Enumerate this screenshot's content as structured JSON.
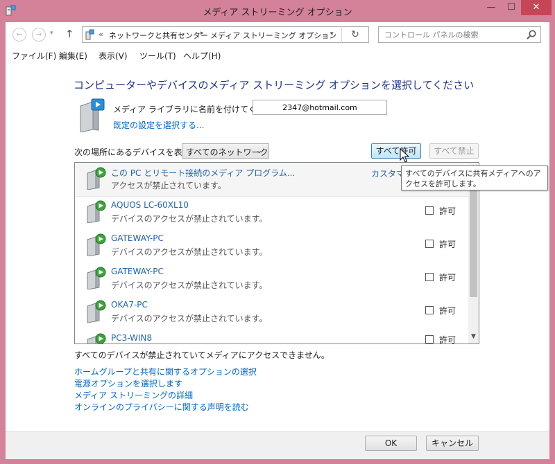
{
  "window": {
    "title": "メディア ストリーミング オプション",
    "controls": {
      "minimize": "—",
      "maximize": "☐",
      "close": "✕"
    },
    "accent_color": "#d4819a",
    "close_color": "#c74655"
  },
  "address_bar": {
    "back_icon": "arrow-left-icon",
    "forward_icon": "arrow-right-icon",
    "up_icon": "arrow-up-icon",
    "overflow": "«",
    "breadcrumbs": [
      "ネットワークと共有センター",
      "メディア ストリーミング オプション"
    ],
    "search_placeholder": "コントロール パネルの検索"
  },
  "menu": [
    "ファイル(F)",
    "編集(E)",
    "表示(V)",
    "ツール(T)",
    "ヘルプ(H)"
  ],
  "main": {
    "heading": "コンピューターやデバイスのメディア ストリーミング オプションを選択してください",
    "library_name_label": "メディア ライブラリに名前を付けてください:",
    "library_name_value": "2347@hotmail.com",
    "defaults_link": "既定の設定を選択する...",
    "show_devices_label": "次の場所にあるデバイスを表示:",
    "network_selected": "すべてのネットワーク",
    "allow_all": "すべて許可",
    "block_all": "すべて禁止",
    "tooltip": "すべてのデバイスに共有メディアへのアクセスを許可します。"
  },
  "devices": [
    {
      "name": "この PC とリモート接続のメディア プログラム...",
      "status": "アクセスが禁止されています。",
      "action": "カスタマイ"
    },
    {
      "name": "AQUOS LC-60XL10",
      "status": "デバイスのアクセスが禁止されています。",
      "checkbox_label": "許可",
      "checked": false
    },
    {
      "name": "GATEWAY-PC",
      "status": "デバイスのアクセスが禁止されています。",
      "checkbox_label": "許可",
      "checked": false
    },
    {
      "name": "GATEWAY-PC",
      "status": "デバイスのアクセスが禁止されています。",
      "checkbox_label": "許可",
      "checked": false
    },
    {
      "name": "OKA7-PC",
      "status": "デバイスのアクセスが禁止されています。",
      "checkbox_label": "許可",
      "checked": false
    },
    {
      "name": "PC3-WIN8",
      "status": "",
      "checkbox_label": "許可",
      "checked": false
    }
  ],
  "summary": "すべてのデバイスが禁止されていてメディアにアクセスできません。",
  "links": [
    "ホームグループと共有に関するオプションの選択",
    "電源オプションを選択します",
    "メディア ストリーミングの詳細",
    "オンラインのプライバシーに関する声明を読む"
  ],
  "footer": {
    "ok": "OK",
    "cancel": "キャンセル"
  }
}
